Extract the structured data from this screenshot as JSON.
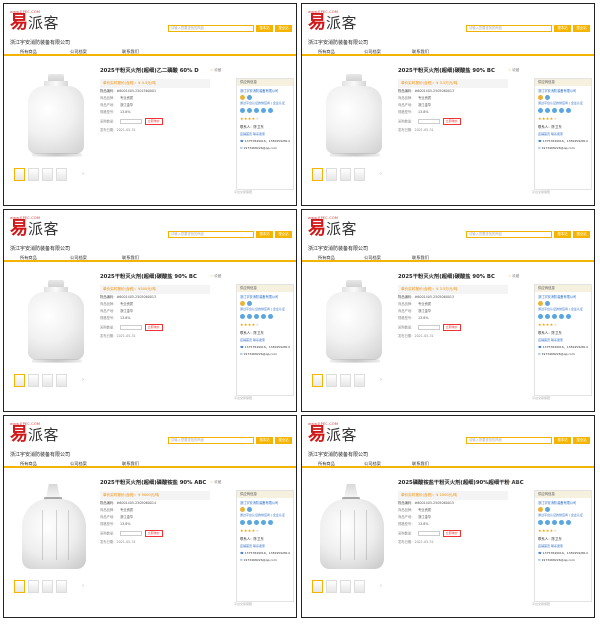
{
  "brand": {
    "logo_mark": "易",
    "logo_name": "派客",
    "logo_url": "www.EPEC.COM"
  },
  "company": "浙江宇安消防装备有限公司",
  "search": {
    "placeholder": "请输入您要查找的商品",
    "btn_site": "搜本站",
    "btn_all": "搜全站"
  },
  "nav": {
    "all_goods": "所有商品",
    "company_home": "公司档案",
    "contact": "联系我们"
  },
  "store_card": {
    "header": "供应商信息",
    "name": "浙江宇安消防装备有限公司",
    "cert": "通过平台认证的供应商 | 企业认证",
    "contact": "联系人：陈卫东",
    "link": "店铺首页  联系卖家",
    "phone": "13757849016，13819592814",
    "email": "1973468226@qq.com",
    "footnote": "平台交易保障"
  },
  "products": [
    {
      "title": "2025干粉灭火剂(超细)乙二磷酸 60% D",
      "price": "单价实时报价(含税)：¥ 4.5元/吨",
      "code": "物品编码：#6001405-2501560001",
      "origin_k": "商品品牌：",
      "origin_v": "专业资质",
      "place_k": "商品产地：",
      "place_v": "浙江金华",
      "spec_k": "规格型号：",
      "spec_v": "13.8%",
      "type": "bottle",
      "date": "发布日期：2021-05-31"
    },
    {
      "title": "2025干粉灭火剂(超细)碳酸盐 90% BC",
      "price": "单价实时报价(含税)：¥ 3.5万元/吨",
      "code": "物品编码：#6001405-2505060013",
      "origin_k": "商品品牌：",
      "origin_v": "专业资质",
      "place_k": "商品产地：",
      "place_v": "浙江金华",
      "spec_k": "规格型号：",
      "spec_v": "13.8%",
      "type": "bottle",
      "date": "发布日期：2021-05-31"
    },
    {
      "title": "2025干粉灭火剂(超细)碳酸盐 90% BC",
      "price": "单价实时报价(含税)：¥300元/吨",
      "code": "物品编码：#6001405-2505060013",
      "origin_k": "商品品牌：",
      "origin_v": "专业资质",
      "place_k": "商品产地：",
      "place_v": "浙江金华",
      "spec_k": "规格型号：",
      "spec_v": "13.8%",
      "type": "bottle",
      "date": "发布日期：2021-05-31"
    },
    {
      "title": "2025干粉灭火剂(超细)碳酸盐 90% BC",
      "price": "单价实时报价(含税)：¥ 3.5万元/吨",
      "code": "物品编码：#6001405-2505060013",
      "origin_k": "商品品牌：",
      "origin_v": "专业资质",
      "place_k": "商品产地：",
      "place_v": "浙江金华",
      "spec_k": "规格型号：",
      "spec_v": "13.8%",
      "type": "bottle",
      "date": "发布日期：2021-05-31"
    },
    {
      "title": "2025干粉灭火剂(超细)磷酸铵盐 90% ABC",
      "price": "单价实时报价(含税)：¥ 9000元/吨",
      "code": "物品编码：#6001405-2505060014",
      "origin_k": "商品品牌：",
      "origin_v": "专业资质",
      "place_k": "商品产地：",
      "place_v": "浙江金华",
      "spec_k": "规格型号：",
      "spec_v": "13.8%",
      "type": "bag",
      "date": "发布日期：2021-05-31"
    },
    {
      "title": "2025磷酸铵盐干粉灭火剂(超细)90%超细干粉 ABC",
      "price": "单价实时报价(含税)：¥ 1000元/吨",
      "code": "物品编码：#6001405-2505060015",
      "origin_k": "商品品牌：",
      "origin_v": "专业资质",
      "place_k": "商品产地：",
      "place_v": "浙江金华",
      "spec_k": "规格型号：",
      "spec_v": "13.8%",
      "type": "bag",
      "date": "发布日期：2021-05-31"
    }
  ],
  "labels": {
    "collect": "收藏",
    "qty": "采购数量：",
    "enquiry": "立即询价",
    "collect_star": "☆"
  }
}
